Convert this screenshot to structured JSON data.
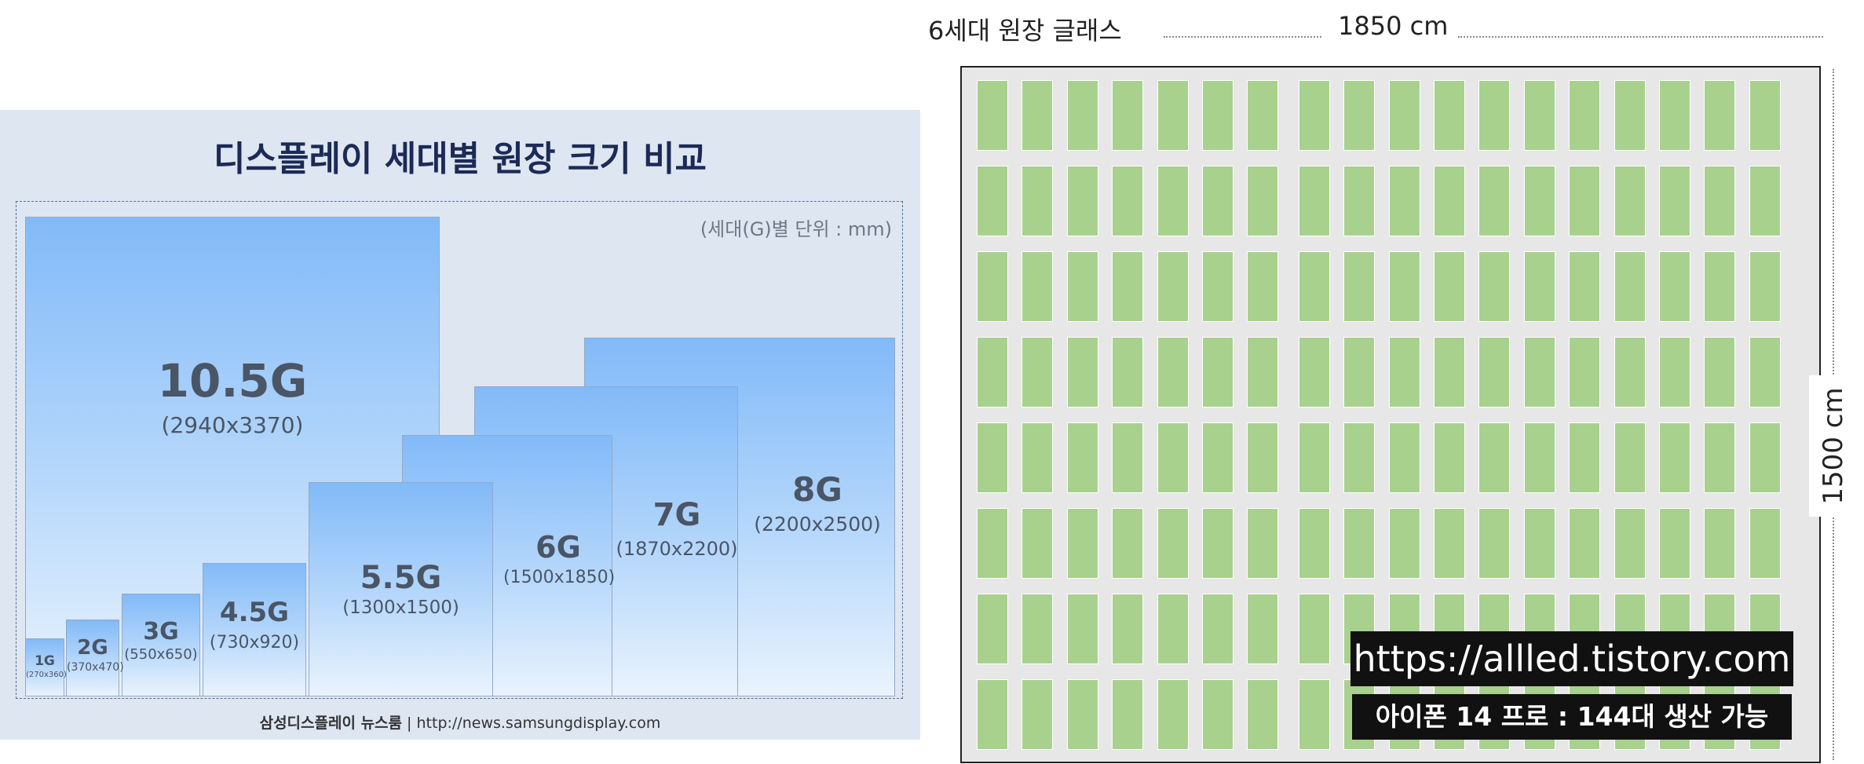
{
  "left": {
    "title": "디스플레이 세대별 원장 크기 비교",
    "unit_note": "(세대(G)별 단위 : mm)",
    "footer_source": "삼성디스플레이 뉴스룸",
    "footer_sep": " | ",
    "footer_url": "http://news.samsungdisplay.com",
    "generations": [
      {
        "name": "1G",
        "size": "(270x360)"
      },
      {
        "name": "2G",
        "size": "(370x470)"
      },
      {
        "name": "3G",
        "size": "(550x650)"
      },
      {
        "name": "4.5G",
        "size": "(730x920)"
      },
      {
        "name": "5.5G",
        "size": "(1300x1500)"
      },
      {
        "name": "6G",
        "size": "(1500x1850)"
      },
      {
        "name": "7G",
        "size": "(1870x2200)"
      },
      {
        "name": "8G",
        "size": "(2200x2500)"
      },
      {
        "name": "10.5G",
        "size": "(2940x3370)"
      }
    ]
  },
  "right": {
    "title": "6세대 원장 글래스",
    "width_label": "1850 cm",
    "height_label": "1500 cm",
    "url": "https://allled.tistory.com",
    "caption": "아이폰 14 프로 : 144대 생산 가능",
    "grid": {
      "columns": 18,
      "rows": 8
    }
  },
  "colors": {
    "panel_bg": "#dde6f1",
    "title_navy": "#1c2a56",
    "phone_green": "#a8d18e",
    "glass_gray": "#e7e7e7"
  }
}
